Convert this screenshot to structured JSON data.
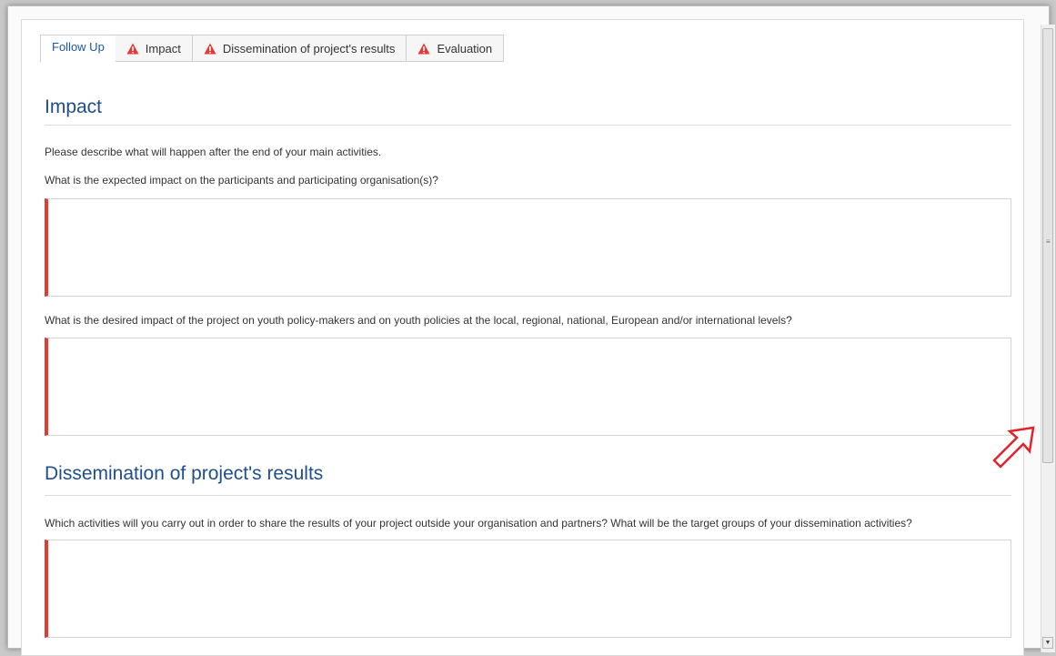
{
  "tabs": [
    {
      "label": "Follow Up",
      "warning": false,
      "active": true
    },
    {
      "label": "Impact",
      "warning": true,
      "active": false
    },
    {
      "label": "Dissemination of project's results",
      "warning": true,
      "active": false
    },
    {
      "label": "Evaluation",
      "warning": true,
      "active": false
    }
  ],
  "impact": {
    "heading": "Impact",
    "intro": "Please describe what will happen after the end of your main activities.",
    "question1": "What is the expected impact on the participants and participating organisation(s)?",
    "question2": "What is the desired impact of the project on youth policy-makers and on youth policies at the local, regional, national, European and/or international levels?"
  },
  "dissemination": {
    "heading": "Dissemination of project's results",
    "question1": "Which activities will you carry out in order to share the results of your project outside your organisation and partners? What will be the target groups of your dissemination activities?"
  },
  "colors": {
    "heading": "#1f4e8c",
    "required_marker": "#e53935",
    "warning_icon": "#e53935",
    "pointer_arrow": "#e0242d"
  },
  "icons": {
    "tab_warning": "warning-triangle-icon",
    "pointer": "pointer-arrow-icon",
    "scroll_down": "scroll-down-arrow-icon"
  }
}
